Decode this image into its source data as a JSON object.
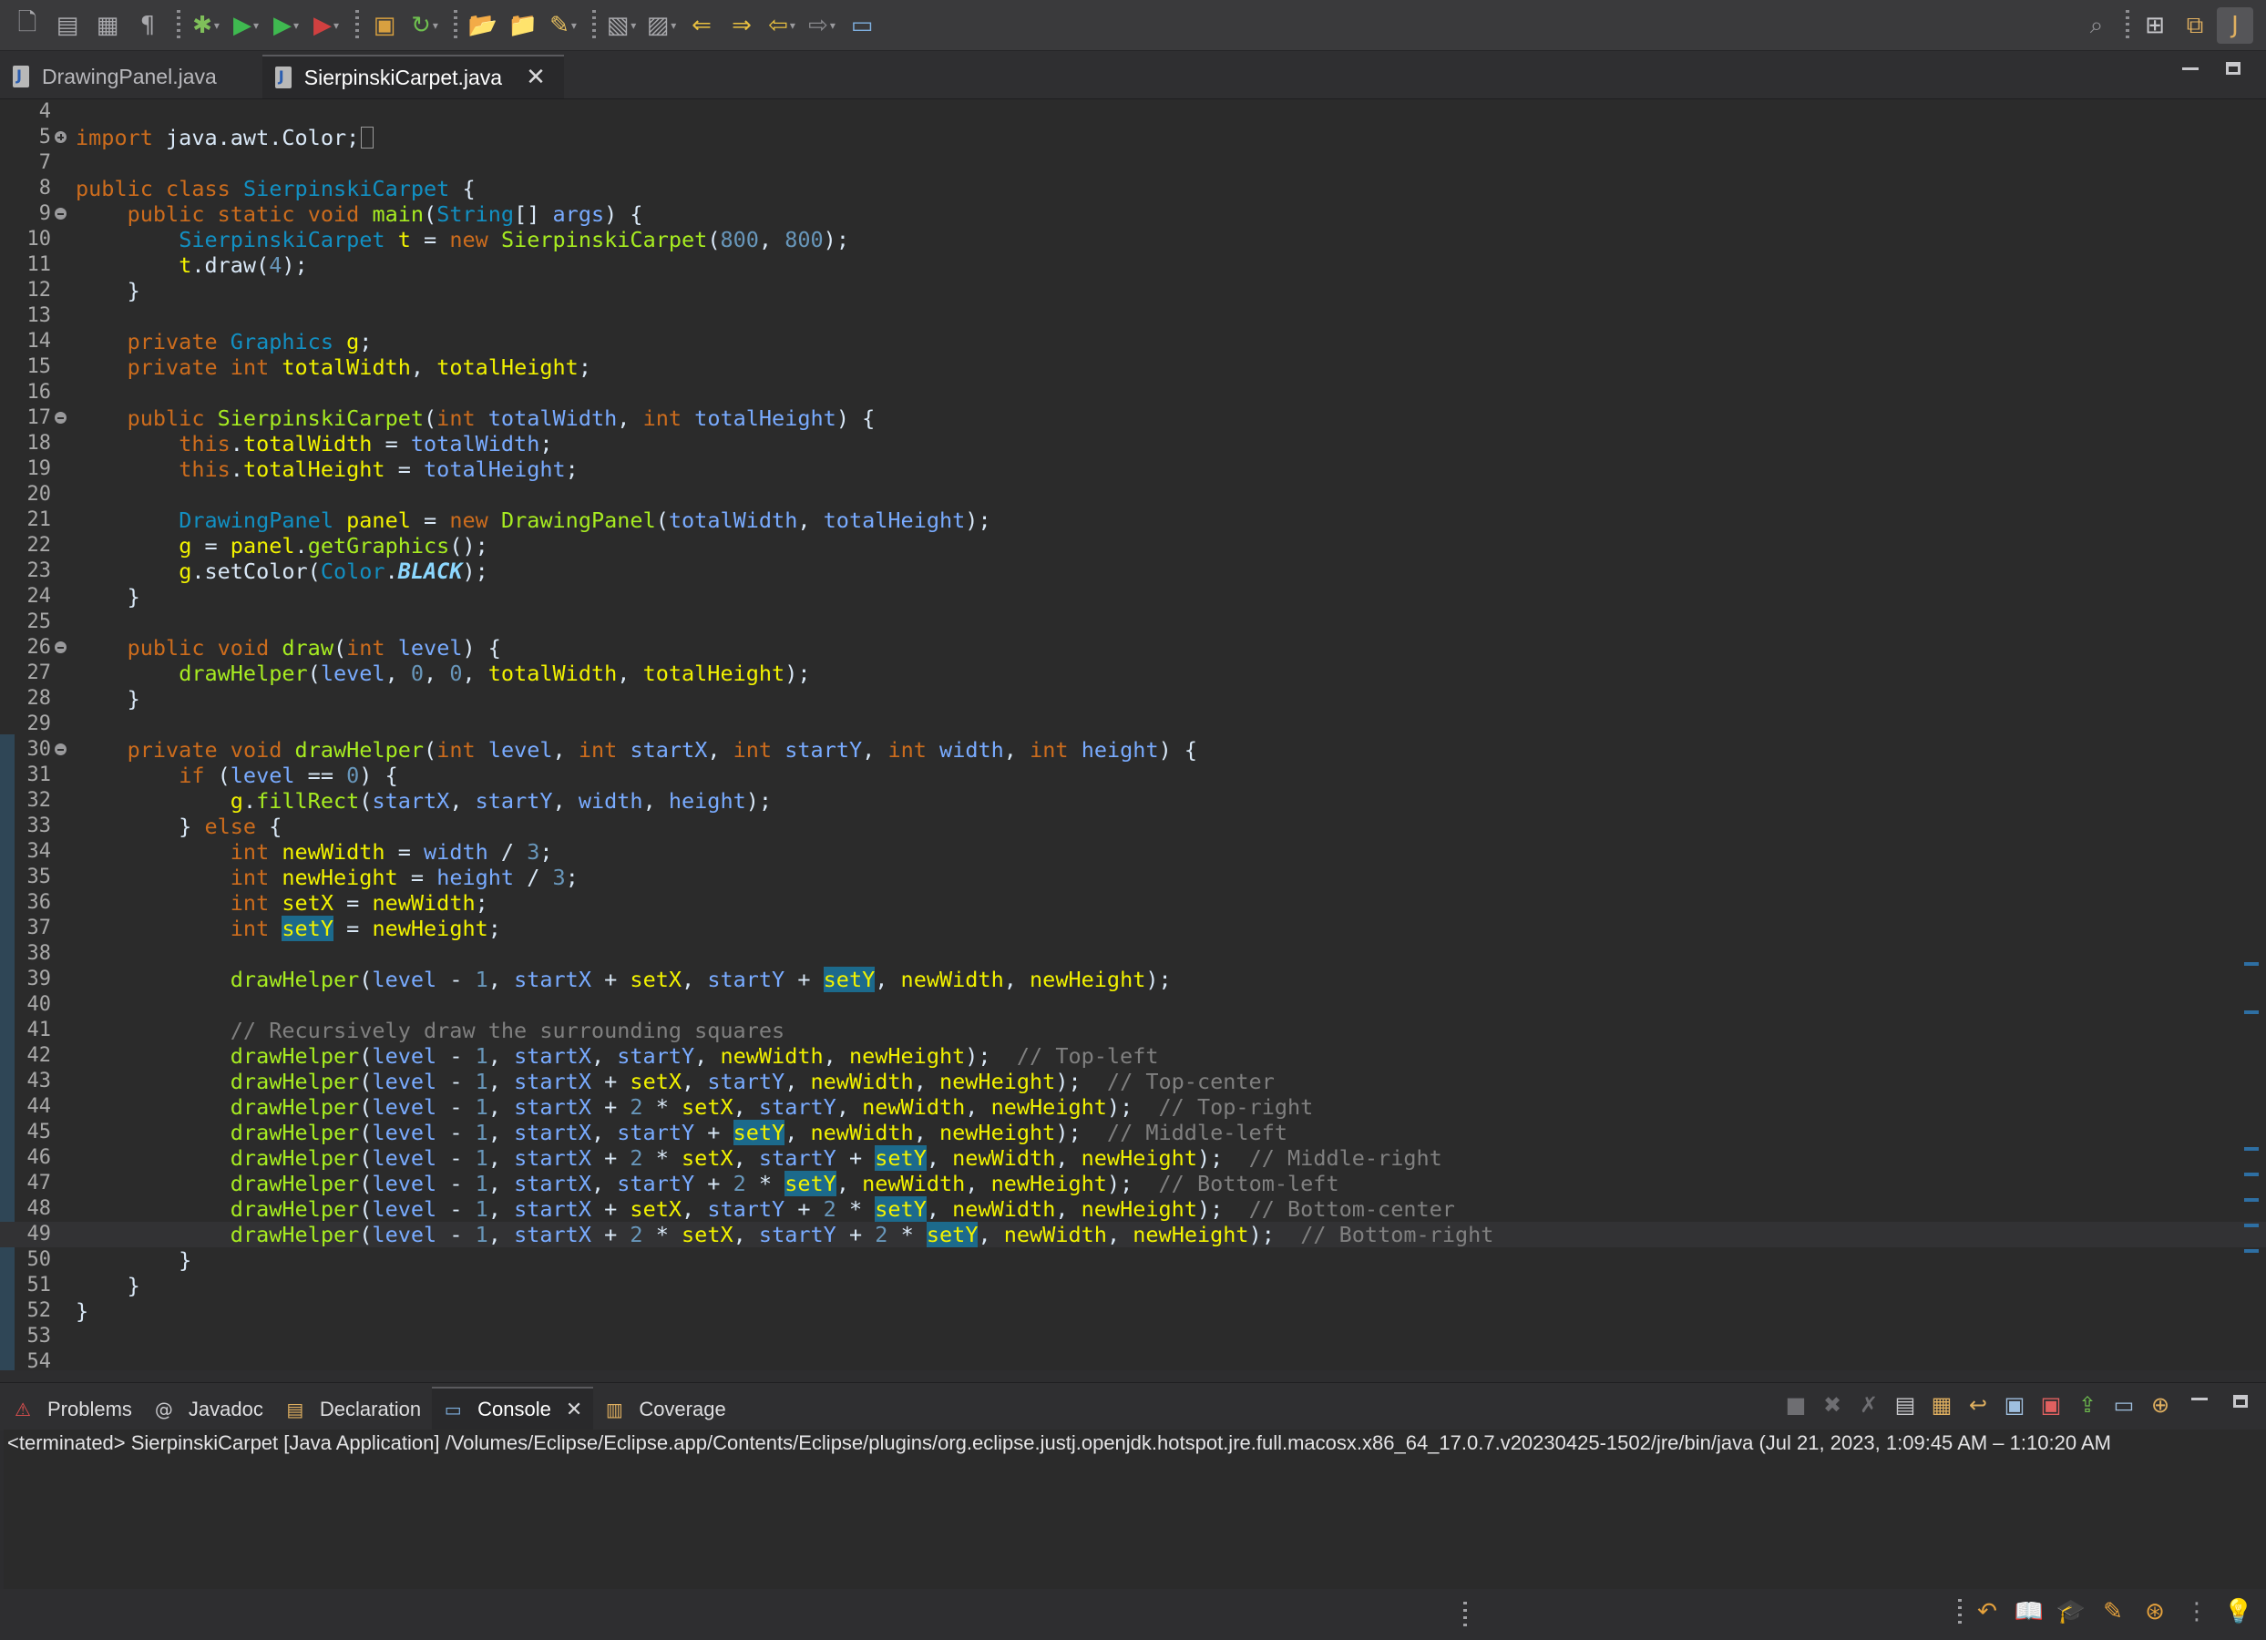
{
  "toolbar": {
    "left_icons": [
      "new-file-icon",
      "save-all-icon",
      "print-icon",
      "pilcrow-icon",
      "debug-bug-icon",
      "run-icon",
      "coverage-run-icon",
      "external-tools-icon",
      "new-java-package-icon",
      "refresh-icon",
      "open-folder-icon",
      "open-task-icon",
      "search-brush-icon",
      "annotation-icon",
      "next-annotation-icon",
      "prev-edit-icon",
      "next-edit-icon",
      "back-icon",
      "forward-icon",
      "pin-editor-icon"
    ],
    "right_icons": [
      "search-icon",
      "open-perspective-icon",
      "java-ee-perspective-icon",
      "java-perspective-icon"
    ]
  },
  "editor_tabs": [
    {
      "label": "DrawingPanel.java",
      "active": false
    },
    {
      "label": "SierpinskiCarpet.java",
      "active": true
    }
  ],
  "editor": {
    "lines": [
      {
        "n": "4",
        "html": ""
      },
      {
        "n": "5",
        "fold": "plus",
        "html": "<span class=\"kw\">import</span> java.awt.Color;<span class=\"cursor-box\"></span>"
      },
      {
        "n": "7",
        "html": ""
      },
      {
        "n": "8",
        "html": "<span class=\"kw\">public</span> <span class=\"kw\">class</span> <span class=\"ty\">SierpinskiCarpet</span> {"
      },
      {
        "n": "9",
        "fold": "minus",
        "html": "    <span class=\"kw\">public</span> <span class=\"kw\">static</span> <span class=\"kw\">void</span> <span class=\"fn\">main</span>(<span class=\"ty\">String</span>[] <span class=\"var\">args</span>) {"
      },
      {
        "n": "10",
        "html": "        <span class=\"ty\">SierpinskiCarpet</span> <span class=\"loc\">t</span> = <span class=\"kw\">new</span> <span class=\"fn\">SierpinskiCarpet</span>(<span class=\"num\">800</span>, <span class=\"num\">800</span>);"
      },
      {
        "n": "11",
        "html": "        <span class=\"loc\">t</span>.draw(<span class=\"num\">4</span>);"
      },
      {
        "n": "12",
        "html": "    }"
      },
      {
        "n": "13",
        "html": ""
      },
      {
        "n": "14",
        "html": "    <span class=\"kw\">private</span> <span class=\"ty\">Graphics</span> <span class=\"loc\">g</span>;"
      },
      {
        "n": "15",
        "html": "    <span class=\"kw\">private</span> <span class=\"kw\">int</span> <span class=\"loc\">totalWidth</span>, <span class=\"loc\">totalHeight</span>;"
      },
      {
        "n": "16",
        "html": ""
      },
      {
        "n": "17",
        "fold": "minus",
        "html": "    <span class=\"kw\">public</span> <span class=\"fn\">SierpinskiCarpet</span>(<span class=\"kw\">int</span> <span class=\"var\">totalWidth</span>, <span class=\"kw\">int</span> <span class=\"var\">totalHeight</span>) {"
      },
      {
        "n": "18",
        "html": "        <span class=\"kw\">this</span>.<span class=\"loc\">totalWidth</span> = <span class=\"var\">totalWidth</span>;"
      },
      {
        "n": "19",
        "html": "        <span class=\"kw\">this</span>.<span class=\"loc\">totalHeight</span> = <span class=\"var\">totalHeight</span>;"
      },
      {
        "n": "20",
        "html": ""
      },
      {
        "n": "21",
        "html": "        <span class=\"ty\">DrawingPanel</span> <span class=\"loc\">panel</span> = <span class=\"kw\">new</span> <span class=\"fn\">DrawingPanel</span>(<span class=\"var\">totalWidth</span>, <span class=\"var\">totalHeight</span>);"
      },
      {
        "n": "22",
        "html": "        <span class=\"loc\">g</span> = <span class=\"loc\">panel</span>.<span class=\"fn\">getGraphics</span>();"
      },
      {
        "n": "23",
        "html": "        <span class=\"loc\">g</span>.setColor(<span class=\"ty\">Color</span>.<span class=\"cst\">BLACK</span>);"
      },
      {
        "n": "24",
        "html": "    }"
      },
      {
        "n": "25",
        "html": ""
      },
      {
        "n": "26",
        "fold": "minus",
        "html": "    <span class=\"kw\">public</span> <span class=\"kw\">void</span> <span class=\"fn\">draw</span>(<span class=\"kw\">int</span> <span class=\"var\">level</span>) {"
      },
      {
        "n": "27",
        "html": "        <span class=\"fn\">drawHelper</span>(<span class=\"var\">level</span>, <span class=\"num\">0</span>, <span class=\"num\">0</span>, <span class=\"loc\">totalWidth</span>, <span class=\"loc\">totalHeight</span>);"
      },
      {
        "n": "28",
        "html": "    }"
      },
      {
        "n": "29",
        "html": ""
      },
      {
        "n": "30",
        "fold": "minus",
        "html": "    <span class=\"kw\">private</span> <span class=\"kw\">void</span> <span class=\"fn\">drawHelper</span>(<span class=\"kw\">int</span> <span class=\"var\">level</span>, <span class=\"kw\">int</span> <span class=\"var\">startX</span>, <span class=\"kw\">int</span> <span class=\"var\">startY</span>, <span class=\"kw\">int</span> <span class=\"var\">width</span>, <span class=\"kw\">int</span> <span class=\"var\">height</span>) {"
      },
      {
        "n": "31",
        "html": "        <span class=\"kw\">if</span> (<span class=\"var\">level</span> == <span class=\"num\">0</span>) {"
      },
      {
        "n": "32",
        "html": "            <span class=\"loc\">g</span>.<span class=\"fn\">fillRect</span>(<span class=\"var\">startX</span>, <span class=\"var\">startY</span>, <span class=\"var\">width</span>, <span class=\"var\">height</span>);"
      },
      {
        "n": "33",
        "html": "        } <span class=\"kw\">else</span> {"
      },
      {
        "n": "34",
        "html": "            <span class=\"kw\">int</span> <span class=\"loc\">newWidth</span> = <span class=\"var\">width</span> / <span class=\"num\">3</span>;"
      },
      {
        "n": "35",
        "html": "            <span class=\"kw\">int</span> <span class=\"loc\">newHeight</span> = <span class=\"var\">height</span> / <span class=\"num\">3</span>;"
      },
      {
        "n": "36",
        "html": "            <span class=\"kw\">int</span> <span class=\"loc\">setX</span> = <span class=\"loc\">newWidth</span>;"
      },
      {
        "n": "37",
        "html": "            <span class=\"kw\">int</span> <span class=\"loc hl\">setY</span> = <span class=\"loc\">newHeight</span>;"
      },
      {
        "n": "38",
        "html": ""
      },
      {
        "n": "39",
        "html": "            <span class=\"fn\">drawHelper</span>(<span class=\"var\">level</span> - <span class=\"num\">1</span>, <span class=\"var\">startX</span> + <span class=\"loc\">setX</span>, <span class=\"var\">startY</span> + <span class=\"loc hl\">setY</span>, <span class=\"loc\">newWidth</span>, <span class=\"loc\">newHeight</span>);"
      },
      {
        "n": "40",
        "html": ""
      },
      {
        "n": "41",
        "html": "            <span class=\"cm\">// Recursively draw the surrounding squares</span>"
      },
      {
        "n": "42",
        "html": "            <span class=\"fn\">drawHelper</span>(<span class=\"var\">level</span> - <span class=\"num\">1</span>, <span class=\"var\">startX</span>, <span class=\"var\">startY</span>, <span class=\"loc\">newWidth</span>, <span class=\"loc\">newHeight</span>);  <span class=\"cm\">// Top-left</span>"
      },
      {
        "n": "43",
        "html": "            <span class=\"fn\">drawHelper</span>(<span class=\"var\">level</span> - <span class=\"num\">1</span>, <span class=\"var\">startX</span> + <span class=\"loc\">setX</span>, <span class=\"var\">startY</span>, <span class=\"loc\">newWidth</span>, <span class=\"loc\">newHeight</span>);  <span class=\"cm\">// Top-center</span>"
      },
      {
        "n": "44",
        "html": "            <span class=\"fn\">drawHelper</span>(<span class=\"var\">level</span> - <span class=\"num\">1</span>, <span class=\"var\">startX</span> + <span class=\"num\">2</span> * <span class=\"loc\">setX</span>, <span class=\"var\">startY</span>, <span class=\"loc\">newWidth</span>, <span class=\"loc\">newHeight</span>);  <span class=\"cm\">// Top-right</span>"
      },
      {
        "n": "45",
        "html": "            <span class=\"fn\">drawHelper</span>(<span class=\"var\">level</span> - <span class=\"num\">1</span>, <span class=\"var\">startX</span>, <span class=\"var\">startY</span> + <span class=\"loc hl\">setY</span>, <span class=\"loc\">newWidth</span>, <span class=\"loc\">newHeight</span>);  <span class=\"cm\">// Middle-left</span>"
      },
      {
        "n": "46",
        "html": "            <span class=\"fn\">drawHelper</span>(<span class=\"var\">level</span> - <span class=\"num\">1</span>, <span class=\"var\">startX</span> + <span class=\"num\">2</span> * <span class=\"loc\">setX</span>, <span class=\"var\">startY</span> + <span class=\"loc hl\">setY</span>, <span class=\"loc\">newWidth</span>, <span class=\"loc\">newHeight</span>);  <span class=\"cm\">// Middle-right</span>"
      },
      {
        "n": "47",
        "html": "            <span class=\"fn\">drawHelper</span>(<span class=\"var\">level</span> - <span class=\"num\">1</span>, <span class=\"var\">startX</span>, <span class=\"var\">startY</span> + <span class=\"num\">2</span> * <span class=\"loc hl\">setY</span>, <span class=\"loc\">newWidth</span>, <span class=\"loc\">newHeight</span>);  <span class=\"cm\">// Bottom-left</span>"
      },
      {
        "n": "48",
        "html": "            <span class=\"fn\">drawHelper</span>(<span class=\"var\">level</span> - <span class=\"num\">1</span>, <span class=\"var\">startX</span> + <span class=\"loc\">setX</span>, <span class=\"var\">startY</span> + <span class=\"num\">2</span> * <span class=\"loc hl\">setY</span>, <span class=\"loc\">newWidth</span>, <span class=\"loc\">newHeight</span>);  <span class=\"cm\">// Bottom-center</span>"
      },
      {
        "n": "49",
        "current": true,
        "html": "            <span class=\"fn\">drawHelper</span>(<span class=\"var\">level</span> - <span class=\"num\">1</span>, <span class=\"var\">startX</span> + <span class=\"num\">2</span> * <span class=\"loc\">setX</span>, <span class=\"var\">startY</span> + <span class=\"num\">2</span> * <span class=\"loc hl\">setY</span>, <span class=\"loc\">newWidth</span>, <span class=\"loc\">newHeight</span>);  <span class=\"cm\">// Bottom-right</span>"
      },
      {
        "n": "50",
        "html": "        }"
      },
      {
        "n": "51",
        "html": "    }"
      },
      {
        "n": "52",
        "html": "}"
      },
      {
        "n": "53",
        "html": ""
      },
      {
        "n": "54",
        "html": ""
      }
    ]
  },
  "bottom_panel": {
    "tabs": [
      {
        "label": "Problems",
        "icon": "problems-icon",
        "active": false
      },
      {
        "label": "Javadoc",
        "icon": "javadoc-icon",
        "active": false
      },
      {
        "label": "Declaration",
        "icon": "declaration-icon",
        "active": false
      },
      {
        "label": "Console",
        "icon": "console-icon",
        "active": true
      },
      {
        "label": "Coverage",
        "icon": "coverage-icon",
        "active": false
      }
    ],
    "console_status": "<terminated> SierpinskiCarpet [Java Application] /Volumes/Eclipse/Eclipse.app/Contents/Eclipse/plugins/org.eclipse.justj.openjdk.hotspot.jre.full.macosx.x86_64_17.0.7.v20230425-1502/jre/bin/java  (Jul 21, 2023, 1:09:45 AM – 1:10:20 AM"
  },
  "colors": {
    "keyword": "#cc6c1d",
    "type": "#1290c3",
    "method": "#a7ec21",
    "parameter": "#79abff",
    "field_local": "#f2f200",
    "number": "#6897bb",
    "comment": "#808080",
    "occurrence_highlight": "#1c6a8c"
  }
}
